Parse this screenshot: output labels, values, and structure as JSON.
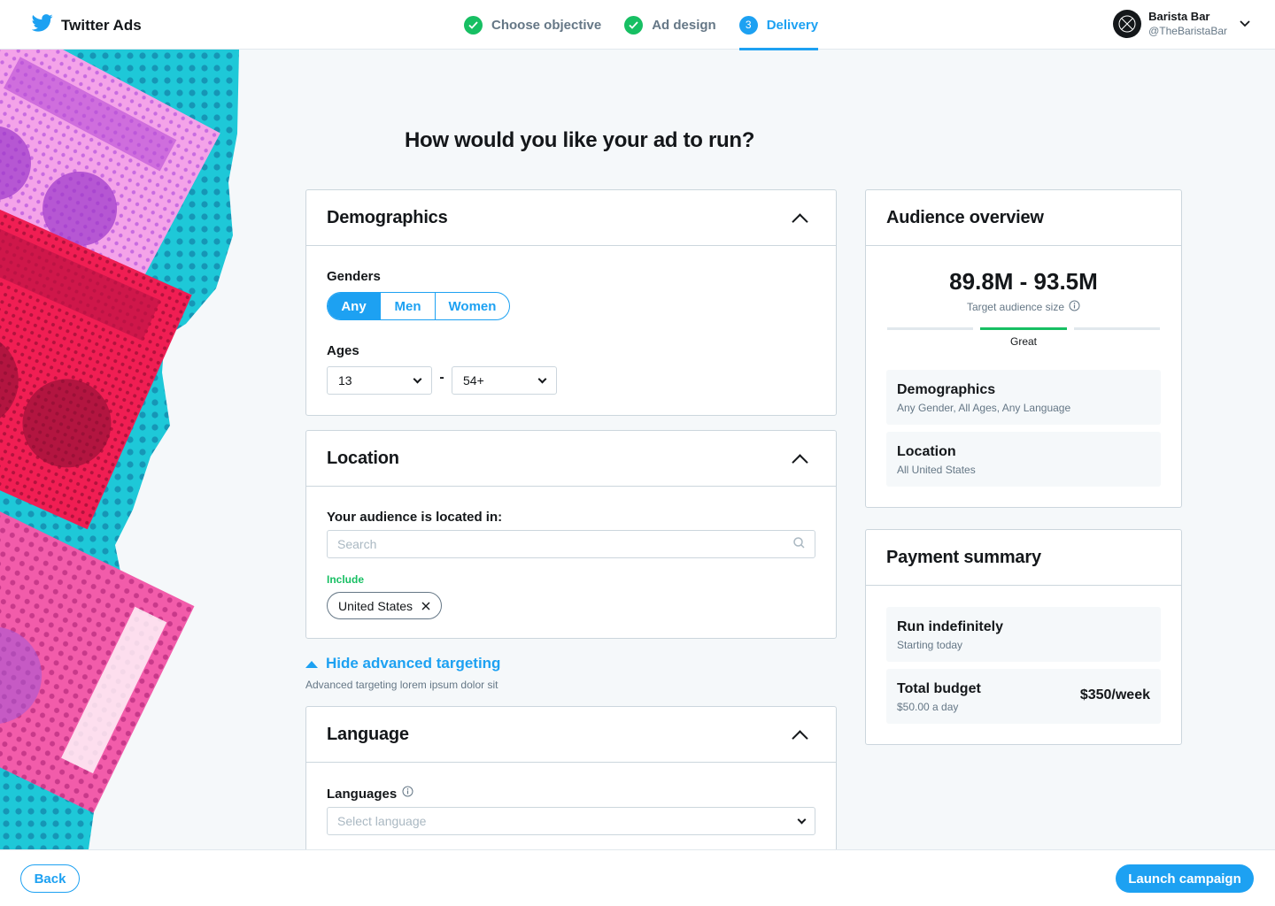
{
  "header": {
    "brand": "Twitter Ads",
    "steps": [
      {
        "label": "Choose objective",
        "state": "done"
      },
      {
        "label": "Ad design",
        "state": "done"
      },
      {
        "label": "Delivery",
        "state": "active",
        "number": "3"
      }
    ],
    "account": {
      "name": "Barista Bar",
      "handle": "@TheBaristaBar"
    }
  },
  "page": {
    "title": "How would you like your ad to run?"
  },
  "demographics": {
    "title": "Demographics",
    "genders_label": "Genders",
    "genders": [
      "Any",
      "Men",
      "Women"
    ],
    "selected_gender": "Any",
    "ages_label": "Ages",
    "age_min": "13",
    "age_sep": "-",
    "age_max": "54+"
  },
  "location": {
    "title": "Location",
    "label": "Your audience is located in:",
    "search_placeholder": "Search",
    "include_label": "Include",
    "included": [
      "United States"
    ]
  },
  "advanced": {
    "link": "Hide advanced targeting",
    "subtitle": "Advanced targeting lorem ipsum dolor sit"
  },
  "language": {
    "title": "Language",
    "label": "Languages",
    "placeholder": "Select language"
  },
  "audience": {
    "title": "Audience overview",
    "size": "89.8M - 93.5M",
    "size_label": "Target audience size",
    "rating": "Great",
    "demographics_title": "Demographics",
    "demographics_sub": "Any Gender, All Ages, Any Language",
    "location_title": "Location",
    "location_sub": "All United States"
  },
  "payment": {
    "title": "Payment summary",
    "run_title": "Run indefinitely",
    "run_sub": "Starting today",
    "budget_title": "Total budget",
    "budget_sub": "$50.00 a day",
    "budget_value": "$350/week"
  },
  "footer": {
    "back": "Back",
    "launch": "Launch campaign"
  },
  "colors": {
    "accent": "#1da1f2",
    "success": "#17bf63",
    "text": "#14171a",
    "muted": "#657786"
  }
}
